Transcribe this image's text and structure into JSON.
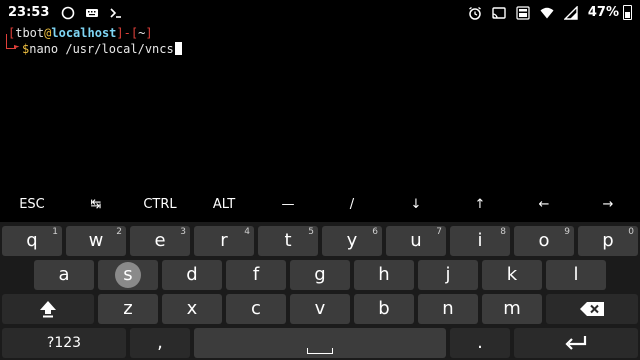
{
  "status_bar": {
    "time": "23:53",
    "battery": "47%",
    "icons_left": [
      "circle-icon",
      "keyboard-icon",
      "terminal-prompt-icon"
    ],
    "icons_right": [
      "alarm-icon",
      "cast-icon",
      "volte-4g-icon",
      "wifi-icon",
      "cell-signal-icon",
      "battery-icon"
    ]
  },
  "terminal": {
    "bracket_open": "[",
    "user": "tbot",
    "at": "@",
    "host": "localhost",
    "sep": "]-[",
    "dir": "~",
    "bracket_close": "]",
    "prompt": "$",
    "command": "nano /usr/local/vncs"
  },
  "extra_keys": [
    "ESC",
    "↹",
    "CTRL",
    "ALT",
    "—",
    "/",
    "↓",
    "↑",
    "←",
    "→"
  ],
  "keyboard": {
    "row1": [
      {
        "k": "q",
        "h": "1"
      },
      {
        "k": "w",
        "h": "2"
      },
      {
        "k": "e",
        "h": "3"
      },
      {
        "k": "r",
        "h": "4"
      },
      {
        "k": "t",
        "h": "5"
      },
      {
        "k": "y",
        "h": "6"
      },
      {
        "k": "u",
        "h": "7"
      },
      {
        "k": "i",
        "h": "8"
      },
      {
        "k": "o",
        "h": "9"
      },
      {
        "k": "p",
        "h": "0"
      }
    ],
    "row2": [
      "a",
      "s",
      "d",
      "f",
      "g",
      "h",
      "j",
      "k",
      "l"
    ],
    "row3": [
      "z",
      "x",
      "c",
      "v",
      "b",
      "n",
      "m"
    ],
    "symbols_label": "?123",
    "comma": ",",
    "period": ".",
    "pressed_key": "s"
  }
}
